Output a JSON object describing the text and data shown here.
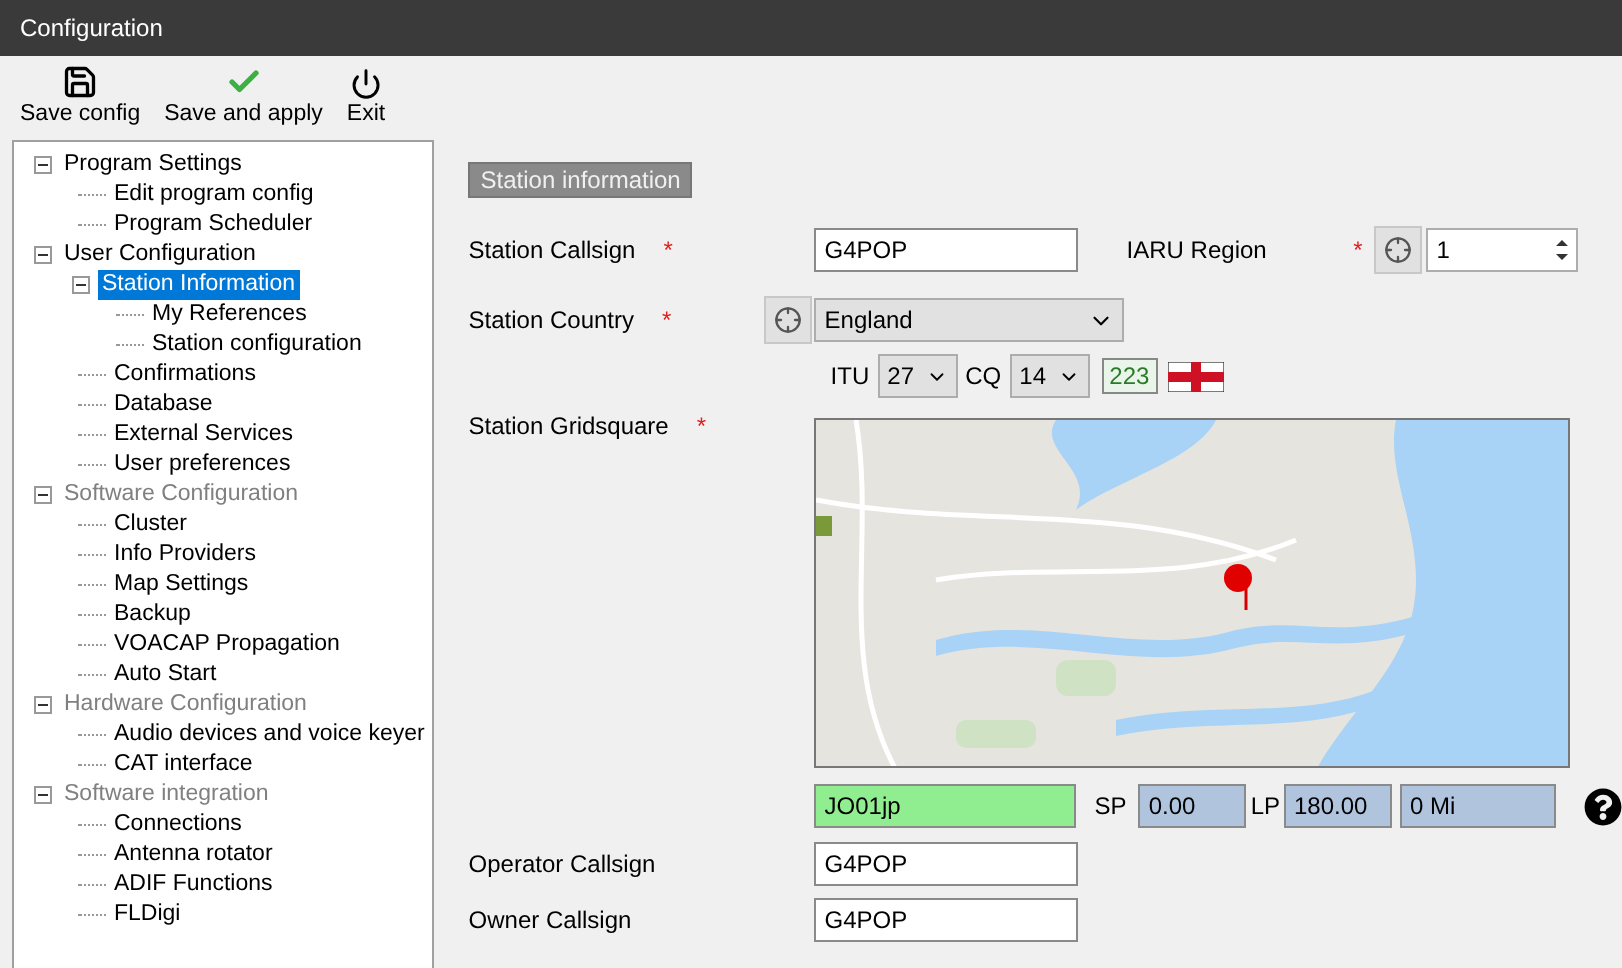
{
  "window": {
    "title": "Configuration"
  },
  "toolbar": [
    {
      "kind": "save",
      "label": "Save config"
    },
    {
      "kind": "apply",
      "label": "Save and apply"
    },
    {
      "kind": "exit",
      "label": "Exit"
    }
  ],
  "tree": [
    {
      "label": "Program Settings",
      "expanded": true,
      "selected": false,
      "dimmed": false,
      "children": [
        {
          "label": "Edit program config",
          "selected": false,
          "dimmed": false
        },
        {
          "label": "Program Scheduler",
          "selected": false,
          "dimmed": false
        }
      ]
    },
    {
      "label": "User Configuration",
      "expanded": true,
      "selected": false,
      "dimmed": false,
      "children": [
        {
          "label": "Station Information",
          "expanded": true,
          "selected": true,
          "dimmed": false,
          "children": [
            {
              "label": "My References",
              "selected": false,
              "dimmed": false
            },
            {
              "label": "Station configuration",
              "selected": false,
              "dimmed": false
            }
          ]
        },
        {
          "label": "Confirmations",
          "selected": false,
          "dimmed": false
        },
        {
          "label": "Database",
          "selected": false,
          "dimmed": false
        },
        {
          "label": "External Services",
          "selected": false,
          "dimmed": false
        },
        {
          "label": "User preferences",
          "selected": false,
          "dimmed": false
        }
      ]
    },
    {
      "label": "Software Configuration",
      "expanded": true,
      "selected": false,
      "dimmed": true,
      "children": [
        {
          "label": "Cluster",
          "selected": false,
          "dimmed": false
        },
        {
          "label": "Info Providers",
          "selected": false,
          "dimmed": false
        },
        {
          "label": "Map Settings",
          "selected": false,
          "dimmed": false
        },
        {
          "label": "Backup",
          "selected": false,
          "dimmed": false
        },
        {
          "label": "VOACAP Propagation",
          "selected": false,
          "dimmed": false
        },
        {
          "label": "Auto Start",
          "selected": false,
          "dimmed": false
        }
      ]
    },
    {
      "label": "Hardware Configuration",
      "expanded": true,
      "selected": false,
      "dimmed": true,
      "children": [
        {
          "label": "Audio devices and voice keyer",
          "selected": false,
          "dimmed": false
        },
        {
          "label": "CAT interface",
          "selected": false,
          "dimmed": false
        }
      ]
    },
    {
      "label": "Software integration",
      "expanded": true,
      "selected": false,
      "dimmed": true,
      "children": [
        {
          "label": "Connections",
          "selected": false,
          "dimmed": false
        },
        {
          "label": "Antenna rotator",
          "selected": false,
          "dimmed": false
        },
        {
          "label": "ADIF Functions",
          "selected": false,
          "dimmed": false
        },
        {
          "label": "FLDigi",
          "selected": false,
          "dimmed": false
        }
      ]
    }
  ],
  "form": {
    "section": "Station information",
    "callsign": {
      "label": "Station Callsign",
      "marker": "*",
      "value": "G4POP"
    },
    "iaru": {
      "label": "IARU Region",
      "marker": "*",
      "value": "1"
    },
    "country": {
      "label": "Station Country",
      "marker": "*",
      "value": "England"
    },
    "itu": {
      "label": "ITU",
      "value": "27"
    },
    "cq": {
      "label": "CQ",
      "value": "14"
    },
    "dxcc": "223",
    "gridsquare": {
      "label": "Station Gridsquare",
      "marker": "*",
      "value": "JO01jp"
    },
    "sp": {
      "label": "SP",
      "value": "0.00"
    },
    "lp": {
      "label": "LP",
      "value": "180.00"
    },
    "distance": "0 Mi",
    "operator": {
      "label": "Operator Callsign",
      "value": "G4POP"
    },
    "owner": {
      "label": "Owner Callsign",
      "value": "G4POP"
    }
  }
}
